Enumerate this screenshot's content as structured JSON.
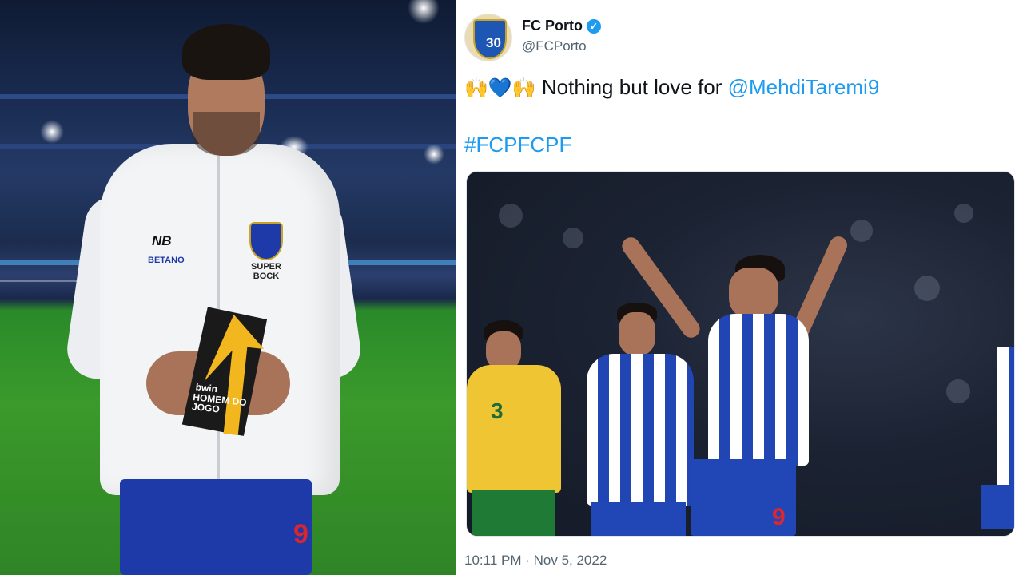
{
  "left_photo": {
    "jacket_sponsor_1": "NB",
    "jacket_sponsor_2": "BETANO",
    "jacket_badge": "SUPER BOCK",
    "shorts_number": "9",
    "trophy_text_1": "bwin",
    "trophy_text_2": "HOMEM DO JOGO"
  },
  "tweet": {
    "avatar_badge": "30",
    "display_name": "FC Porto",
    "verified_icon": "verified-badge",
    "handle": "@FCPorto",
    "emoji_1": "🙌",
    "emoji_2": "💙",
    "emoji_3": "🙌",
    "text_prefix": " Nothing but love for ",
    "mention": "@MehdiTaremi9",
    "hashtag": "#FCPFCPF",
    "media": {
      "yellow_player_number": "3",
      "blue_player_number": "9"
    },
    "timestamp": "10:11 PM · Nov 5, 2022"
  },
  "colors": {
    "link_blue": "#1d9bf0",
    "porto_blue": "#2145b3",
    "muted_text": "#536471"
  }
}
